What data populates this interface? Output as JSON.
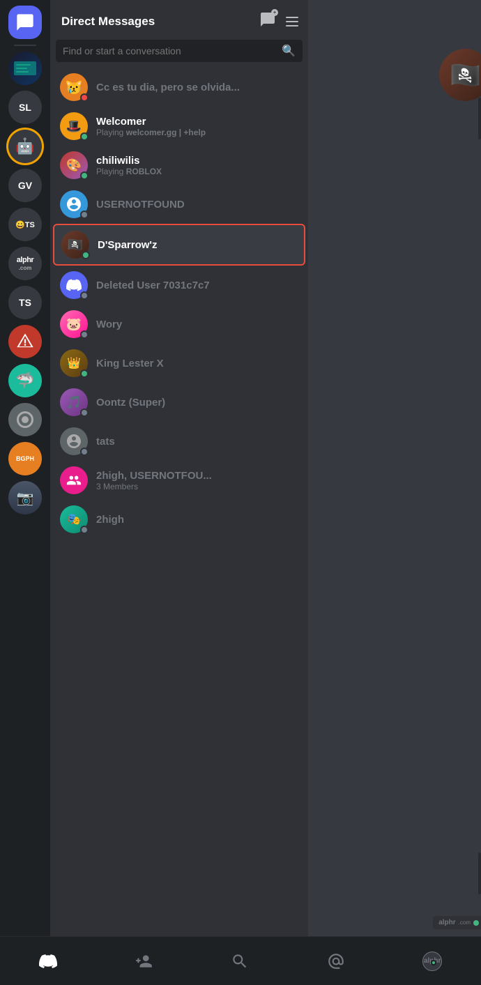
{
  "app": {
    "title": "Direct Messages"
  },
  "header": {
    "title": "Direct Messages",
    "new_dm_label": "New DM",
    "menu_label": "Menu"
  },
  "search": {
    "placeholder": "Find or start a conversation"
  },
  "dm_list": [
    {
      "id": "user-first",
      "name": "Cc es tu dia, pero se olvida...",
      "subtitle": "",
      "status": "dnd",
      "avatar_type": "emoji",
      "avatar_emoji": "😿",
      "active": false
    },
    {
      "id": "welcomer",
      "name": "Welcomer",
      "subtitle": "Playing welcomer.gg | +help",
      "status": "online",
      "avatar_type": "color",
      "avatar_color": "bg-gold",
      "active": false
    },
    {
      "id": "chiliwilis",
      "name": "chiliwilis",
      "subtitle": "Playing ROBLOX",
      "status": "online",
      "avatar_type": "color",
      "avatar_color": "bg-purple",
      "active": false
    },
    {
      "id": "usernotfound",
      "name": "USERNOTFOUND",
      "subtitle": "",
      "status": "offline",
      "avatar_type": "color",
      "avatar_color": "bg-blue",
      "active": false
    },
    {
      "id": "dsparrowz",
      "name": "D'Sparrow'z",
      "subtitle": "",
      "status": "online",
      "avatar_type": "photo",
      "avatar_color": "bg-dark",
      "active": true
    },
    {
      "id": "deleted-user",
      "name": "Deleted User 7031c7c7",
      "subtitle": "",
      "status": "offline",
      "avatar_type": "discord",
      "avatar_color": "bg-discord",
      "active": false
    },
    {
      "id": "wory",
      "name": "Wory",
      "subtitle": "",
      "status": "offline",
      "avatar_type": "color",
      "avatar_color": "bg-pink",
      "active": false
    },
    {
      "id": "king-lester",
      "name": "King Lester X",
      "subtitle": "",
      "status": "online",
      "avatar_type": "color",
      "avatar_color": "bg-gold",
      "active": false
    },
    {
      "id": "oontz",
      "name": "Oontz (Super)",
      "subtitle": "",
      "status": "offline",
      "avatar_type": "color",
      "avatar_color": "bg-purple",
      "active": false
    },
    {
      "id": "tats",
      "name": "tats",
      "subtitle": "",
      "status": "offline",
      "avatar_type": "color",
      "avatar_color": "bg-dark",
      "active": false
    },
    {
      "id": "2high-group",
      "name": "2high, USERNOTFOU...",
      "subtitle": "3 Members",
      "status": "none",
      "avatar_type": "group",
      "avatar_color": "bg-pink",
      "active": false
    },
    {
      "id": "2high",
      "name": "2high",
      "subtitle": "",
      "status": "offline",
      "avatar_type": "color",
      "avatar_color": "bg-teal",
      "active": false
    }
  ],
  "servers": [
    {
      "id": "dm",
      "label": "DM",
      "type": "dm"
    },
    {
      "id": "server1",
      "label": "SL",
      "type": "text",
      "color": "#36393f"
    },
    {
      "id": "server2",
      "label": "",
      "type": "emoji",
      "emoji": "🤖",
      "outline": "gold"
    },
    {
      "id": "server3",
      "label": "GV",
      "type": "text",
      "color": "#36393f"
    },
    {
      "id": "server4",
      "label": "😀TS",
      "type": "text",
      "color": "#36393f"
    },
    {
      "id": "server5",
      "label": "alphr",
      "type": "text",
      "color": "#36393f"
    },
    {
      "id": "server6",
      "label": "TS",
      "type": "text",
      "color": "#36393f"
    },
    {
      "id": "server7",
      "label": "",
      "type": "color",
      "color": "#c0392b"
    },
    {
      "id": "server8",
      "label": "",
      "type": "color",
      "color": "#1abc9c"
    },
    {
      "id": "server9",
      "label": "",
      "type": "color",
      "color": "#5d6568"
    },
    {
      "id": "server10",
      "label": "BGPH",
      "type": "text",
      "color": "#e67e22"
    },
    {
      "id": "server11",
      "label": "",
      "type": "photo",
      "color": "#5d6568"
    }
  ],
  "bottom_nav": {
    "items": [
      {
        "id": "nav-home",
        "icon": "discord",
        "label": ""
      },
      {
        "id": "nav-friends",
        "icon": "friends",
        "label": ""
      },
      {
        "id": "nav-search",
        "icon": "search",
        "label": ""
      },
      {
        "id": "nav-mentions",
        "icon": "at",
        "label": ""
      },
      {
        "id": "nav-alphr",
        "icon": "alphr",
        "label": ""
      }
    ]
  }
}
